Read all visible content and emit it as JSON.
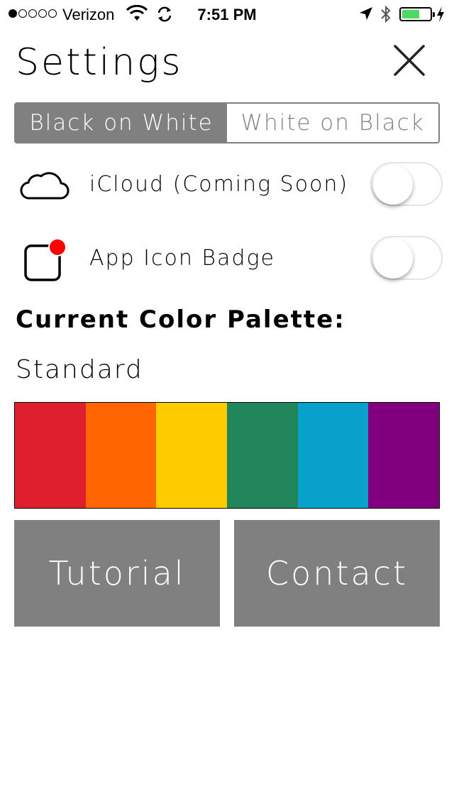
{
  "status_bar": {
    "signal_bars_filled": 1,
    "signal_bars_total": 5,
    "carrier": "Verizon",
    "time": "7:51 PM",
    "battery_level": 0.62,
    "battery_color": "#4cd964",
    "icons": [
      "wifi-icon",
      "sync-icon",
      "location-arrow-icon",
      "bluetooth-icon",
      "battery-icon",
      "charging-bolt-icon"
    ]
  },
  "header": {
    "title": "Settings",
    "close_icon": "close-icon"
  },
  "theme_selector": {
    "options": [
      "Black on White",
      "White on Black"
    ],
    "selected": "Black on White"
  },
  "settings": [
    {
      "icon": "cloud-icon",
      "label": "iCloud (Coming Soon)",
      "enabled": false
    },
    {
      "icon": "app-badge-icon",
      "label": "App Icon Badge",
      "enabled": false
    }
  ],
  "palette": {
    "heading": "Current Color Palette:",
    "name": "Standard",
    "colors": [
      "#df1f2d",
      "#ff6600",
      "#ffcc00",
      "#21875a",
      "#08a1cc",
      "#800080"
    ]
  },
  "buttons": {
    "tutorial": "Tutorial",
    "contact": "Contact"
  },
  "theme": {
    "accent_gray": "#808080",
    "badge_red": "#ff0000"
  }
}
